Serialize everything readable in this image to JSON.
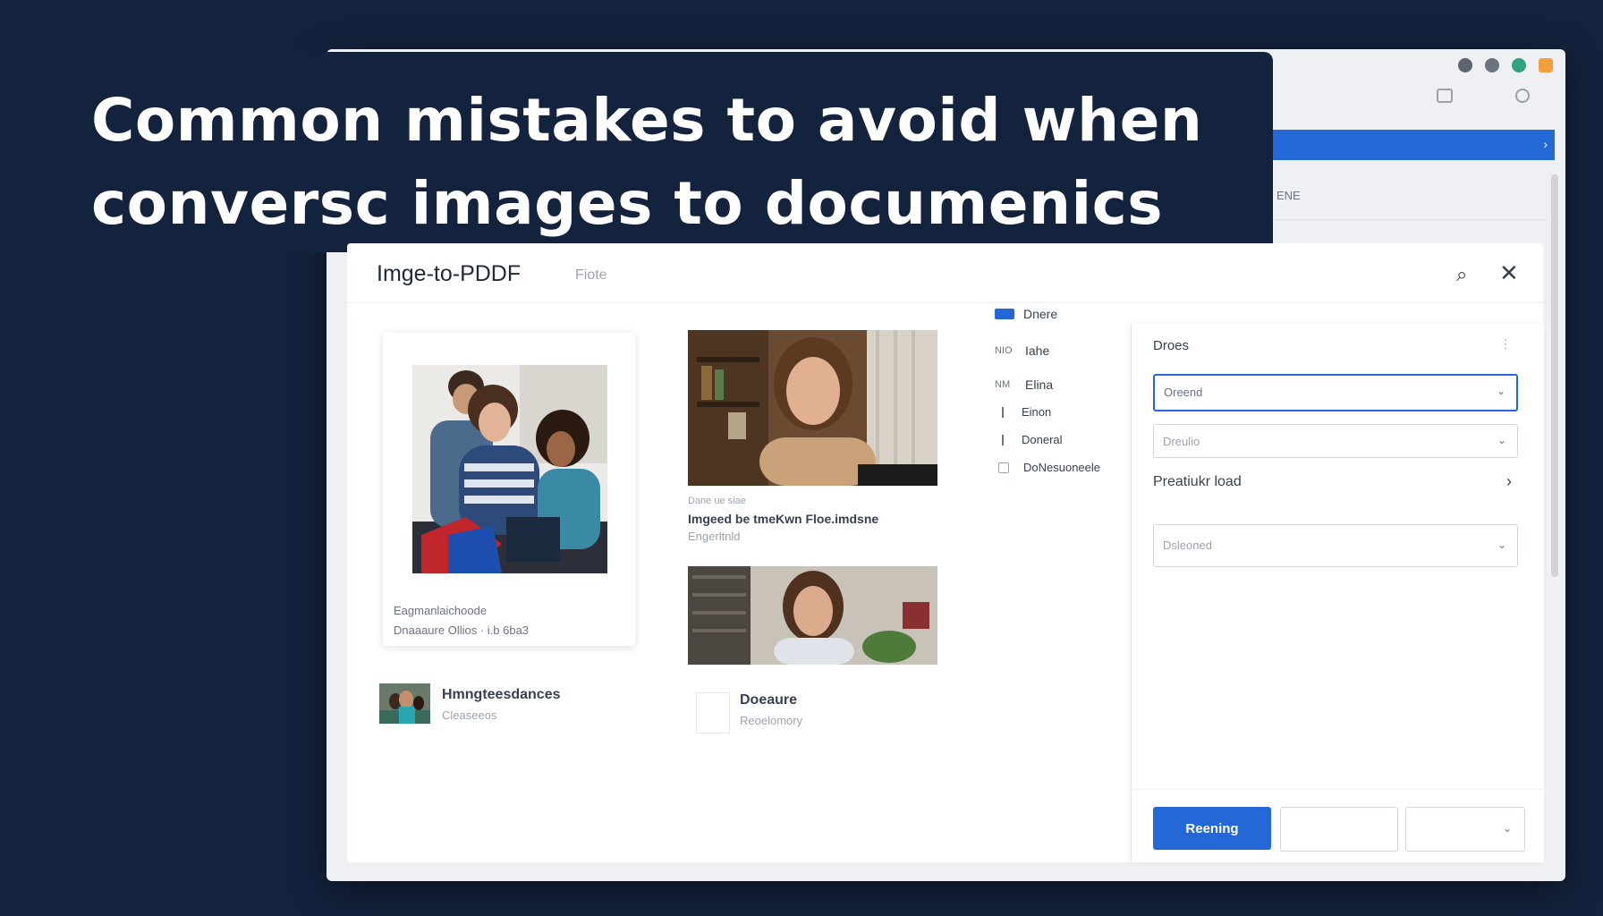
{
  "banner": {
    "line1": "Common mistakes to avoid when",
    "line2": "conversc images to documenics"
  },
  "browser": {
    "ext_icons": [
      "shield-icon",
      "refresh-icon",
      "sync-icon",
      "tag-icon"
    ],
    "bluebar_arrow": "›",
    "subtext": "ENE"
  },
  "app": {
    "title": "Imge-to-PDDF",
    "tag": "Fiote",
    "search_icon": "⌕",
    "close_icon": "✕"
  },
  "card": {
    "line1": "Eagmanlaichoode",
    "line2": "Dnaaaure Ollios · i.b 6ba3"
  },
  "gallery": {
    "caption_small": "Dane ue siae",
    "caption_title": "Imgeed be tmeKwn Floe.imdsne",
    "caption_sub": "Engerltnld"
  },
  "thumb_item": {
    "title": "Hmngteesdances",
    "sub": "Cleaseeos"
  },
  "doc_item": {
    "title": "Doeaure",
    "sub": "Reoelomory"
  },
  "nav": [
    {
      "icon": "blue",
      "label": "Dnere"
    },
    {
      "icon": "gray",
      "prefix": "NIO",
      "label": "Iahe"
    },
    {
      "icon": "gray",
      "prefix": "NM",
      "label": "Elina"
    },
    {
      "icon": "bar",
      "label": "Einon"
    },
    {
      "icon": "bar",
      "label": "Doneral"
    },
    {
      "icon": "sq",
      "label": "DoNesuoneele"
    }
  ],
  "panel": {
    "label": "Droes",
    "more": "⋮",
    "field1": "Oreend",
    "field2": "Dreulio",
    "section": "Preatiukr load",
    "section_arrow": "›",
    "field3": "Dsleoned",
    "primary_button": "Reening",
    "chevron": "⌄"
  },
  "colors": {
    "background": "#13223d",
    "accent": "#2467d6",
    "panel": "#ffffff"
  }
}
